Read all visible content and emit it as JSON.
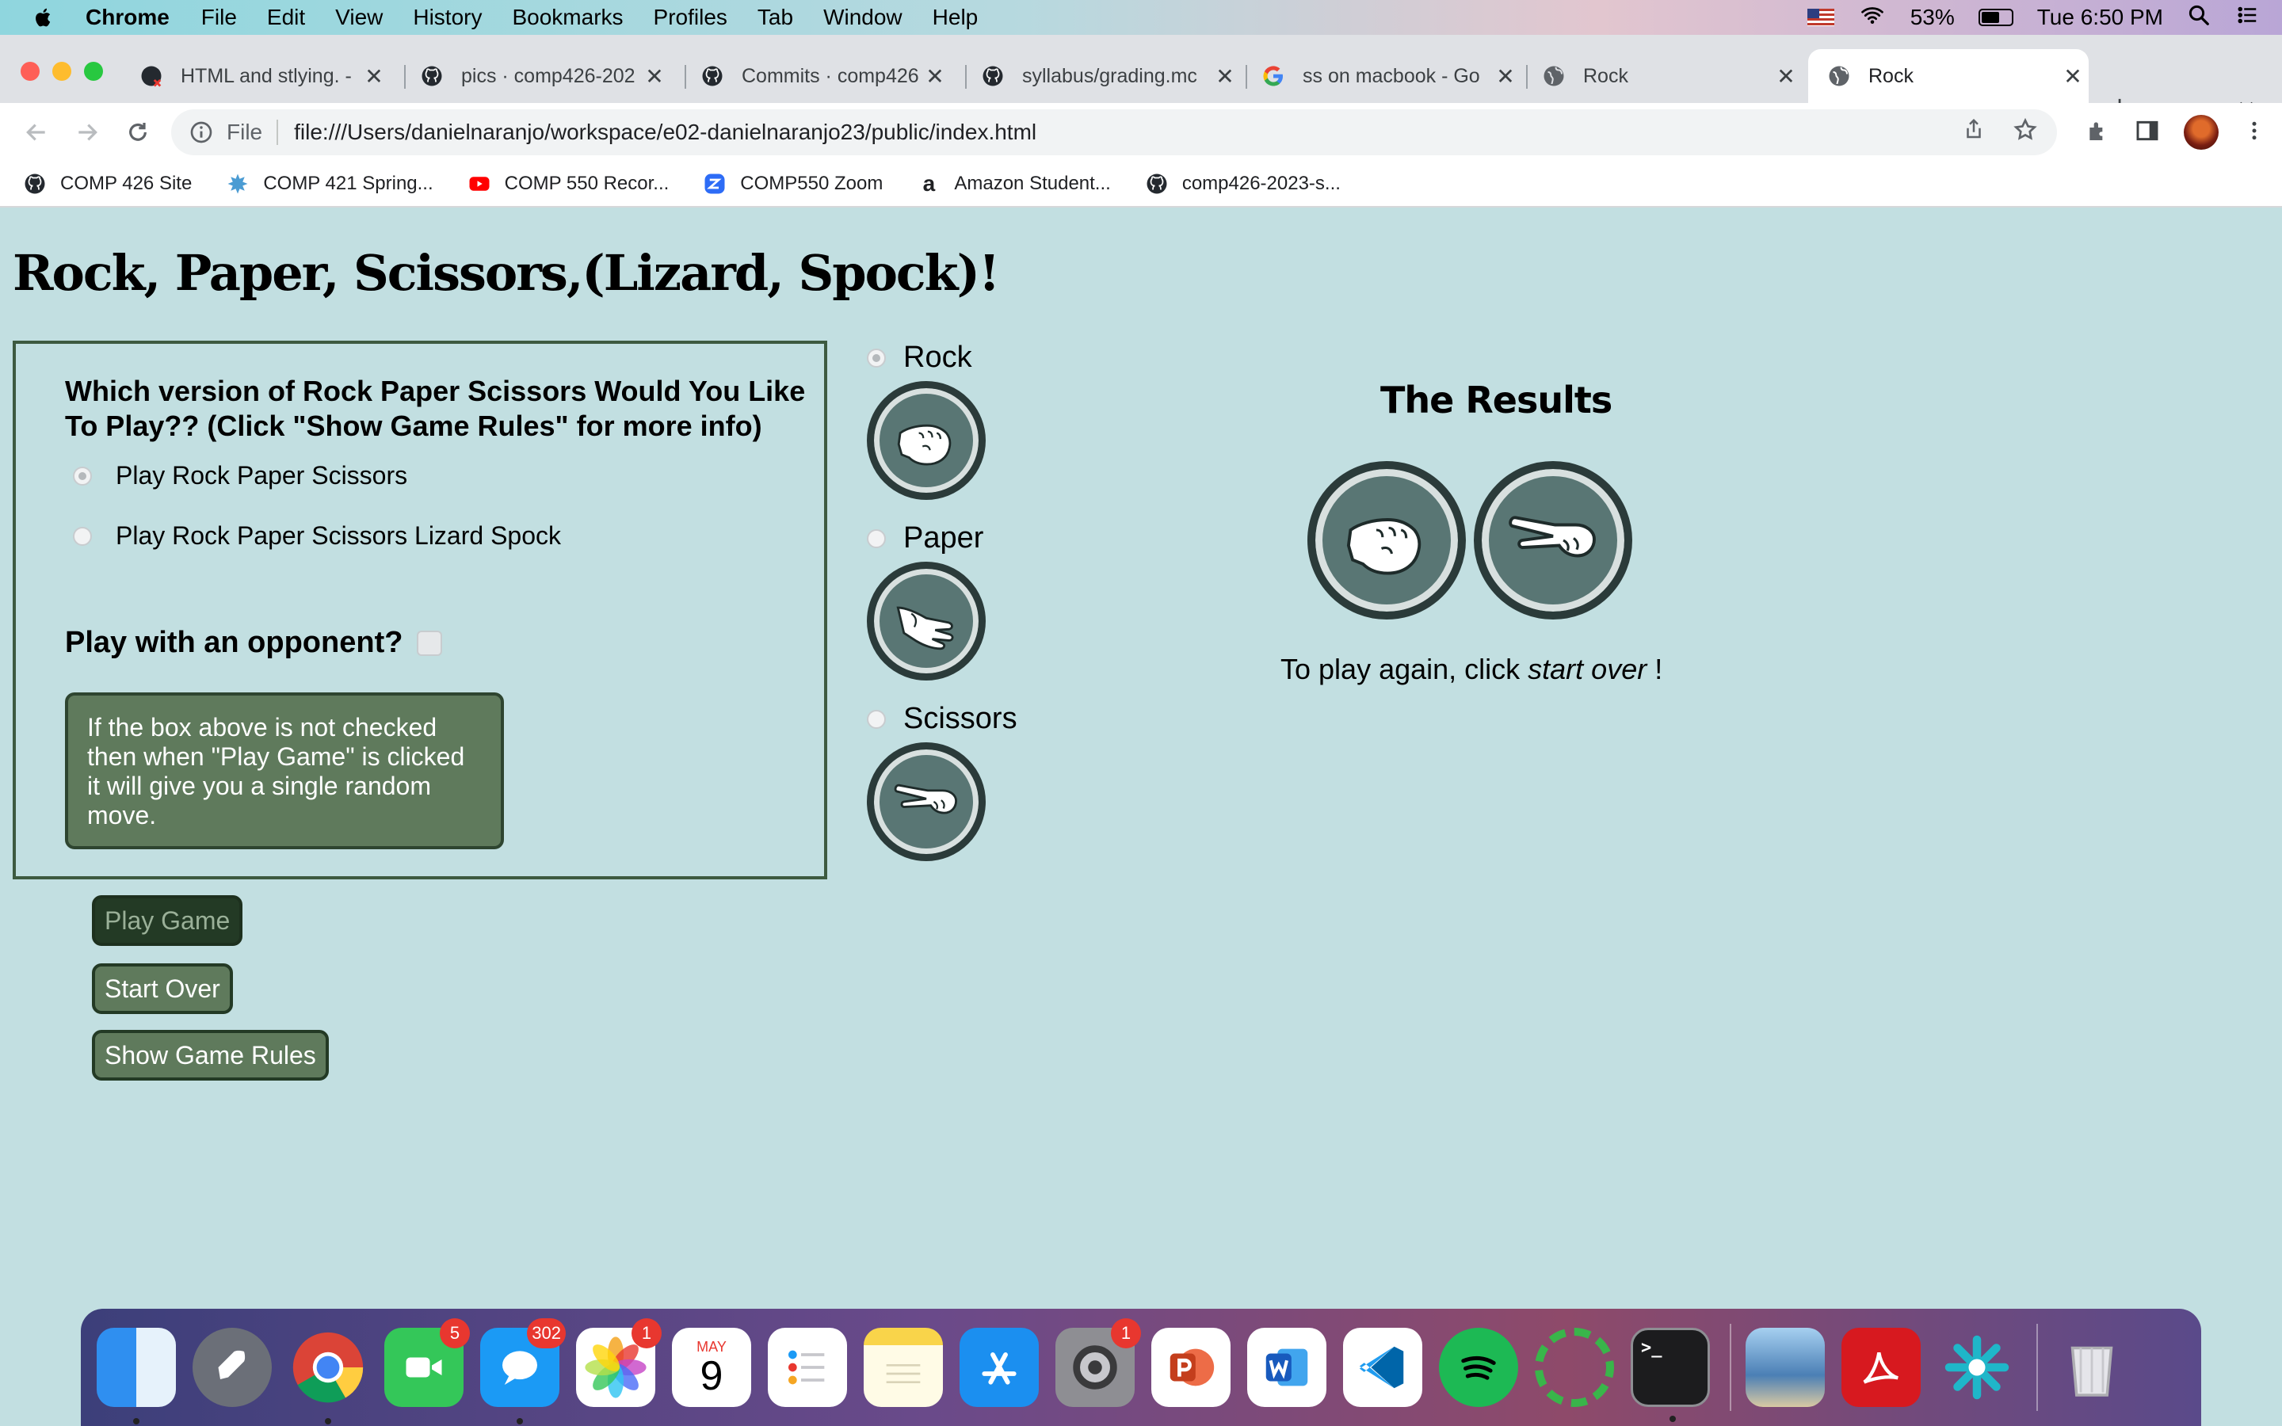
{
  "menubar": {
    "app": "Chrome",
    "items": [
      "File",
      "Edit",
      "View",
      "History",
      "Bookmarks",
      "Profiles",
      "Tab",
      "Window",
      "Help"
    ],
    "battery": "53%",
    "clock": "Tue 6:50 PM"
  },
  "tabs": [
    {
      "title": "HTML and stlying. -"
    },
    {
      "title": "pics · comp426-202"
    },
    {
      "title": "Commits · comp426"
    },
    {
      "title": "syllabus/grading.mc"
    },
    {
      "title": "ss on macbook - Go"
    },
    {
      "title": "Rock"
    },
    {
      "title": "Rock"
    }
  ],
  "address": {
    "scheme_label": "File",
    "url": "file:///Users/danielnaranjo/workspace/e02-danielnaranjo23/public/index.html"
  },
  "bookmarks": [
    "COMP 426 Site",
    "COMP 421 Spring...",
    "COMP 550 Recor...",
    "COMP550 Zoom",
    "Amazon Student...",
    "comp426-2023-s..."
  ],
  "page": {
    "title": "Rock, Paper, Scissors,(Lizard, Spock)!",
    "question": "Which version of Rock Paper Scissors Would You Like To Play?? (Click \"Show Game Rules\" for more info)",
    "option_rps": "Play Rock Paper Scissors",
    "option_rpsls": "Play Rock Paper Scissors Lizard Spock",
    "opponent_label": "Play with an opponent?",
    "note": "If the box above is not checked then when \"Play Game\" is clicked it will give you a single random move.",
    "buttons": {
      "play": "Play Game",
      "start_over": "Start Over",
      "rules": "Show Game Rules"
    },
    "moves": [
      "Rock",
      "Paper",
      "Scissors"
    ],
    "results_title": "The Results",
    "again_prefix": "To play again, click ",
    "again_link": "start over",
    "again_suffix": " !"
  },
  "dock": {
    "badges": {
      "facetime": "5",
      "messages": "302",
      "photos": "1",
      "settings": "1"
    },
    "calendar_month": "MAY",
    "calendar_day": "9"
  }
}
